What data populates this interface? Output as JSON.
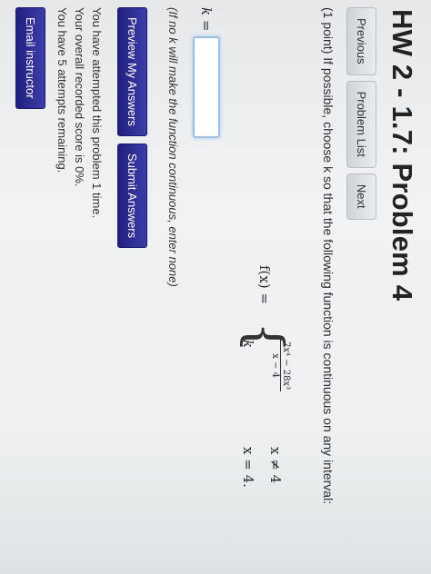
{
  "page": {
    "title": "HW 2 - 1.7: Problem 4"
  },
  "nav": {
    "previous": "Previous",
    "problem_list": "Problem List",
    "next": "Next"
  },
  "problem": {
    "points": "(1 point)",
    "text": "If possible, choose k so that the following function is continuous on any interval:",
    "function_lhs": "f(x) =",
    "case1_numerator": "7x⁴ − 28x³",
    "case1_denominator": "x − 4",
    "case1_condition": "x ≠ 4",
    "case2_expr": "k",
    "case2_condition": "x = 4.",
    "answer_label": "k =",
    "answer_value": "",
    "hint": "(If no k will make the function continuous, enter none)"
  },
  "actions": {
    "preview": "Preview My Answers",
    "submit": "Submit Answers"
  },
  "status": {
    "attempts": "You have attempted this problem 1 time.",
    "score": "Your overall recorded score is 0%.",
    "remaining": "You have 5 attempts remaining."
  },
  "footer": {
    "email": "Email instructor"
  }
}
